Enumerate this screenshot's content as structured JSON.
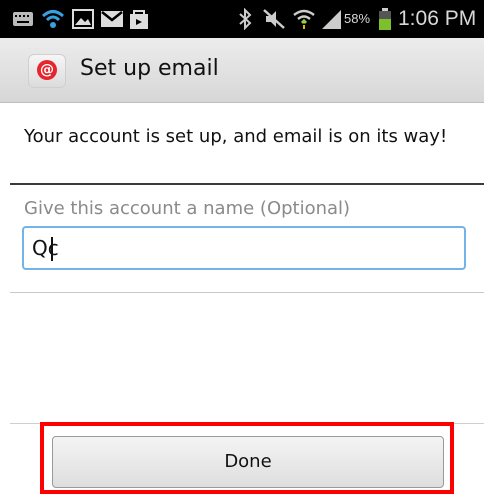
{
  "status_bar": {
    "battery": "58%",
    "time": "1:06 PM",
    "icons": [
      "keyboard-icon",
      "wifi-icon",
      "gallery-icon",
      "gmail-icon",
      "shopping-bag-icon",
      "bluetooth-icon",
      "mute-icon",
      "wifi-signal-icon",
      "cell-signal-icon",
      "battery-icon"
    ]
  },
  "action_bar": {
    "title": "Set up email",
    "icon": "email-app-icon"
  },
  "content": {
    "message": "Your account is set up, and email is on its way!",
    "name_field": {
      "label": "Give this account a name (Optional)",
      "value": "Qc"
    }
  },
  "footer": {
    "done_label": "Done"
  },
  "colors": {
    "status_bar_bg": "#000000",
    "input_focus_border": "#74b3e6",
    "highlight_border": "#ff0000",
    "app_icon_red": "#e5262d"
  }
}
